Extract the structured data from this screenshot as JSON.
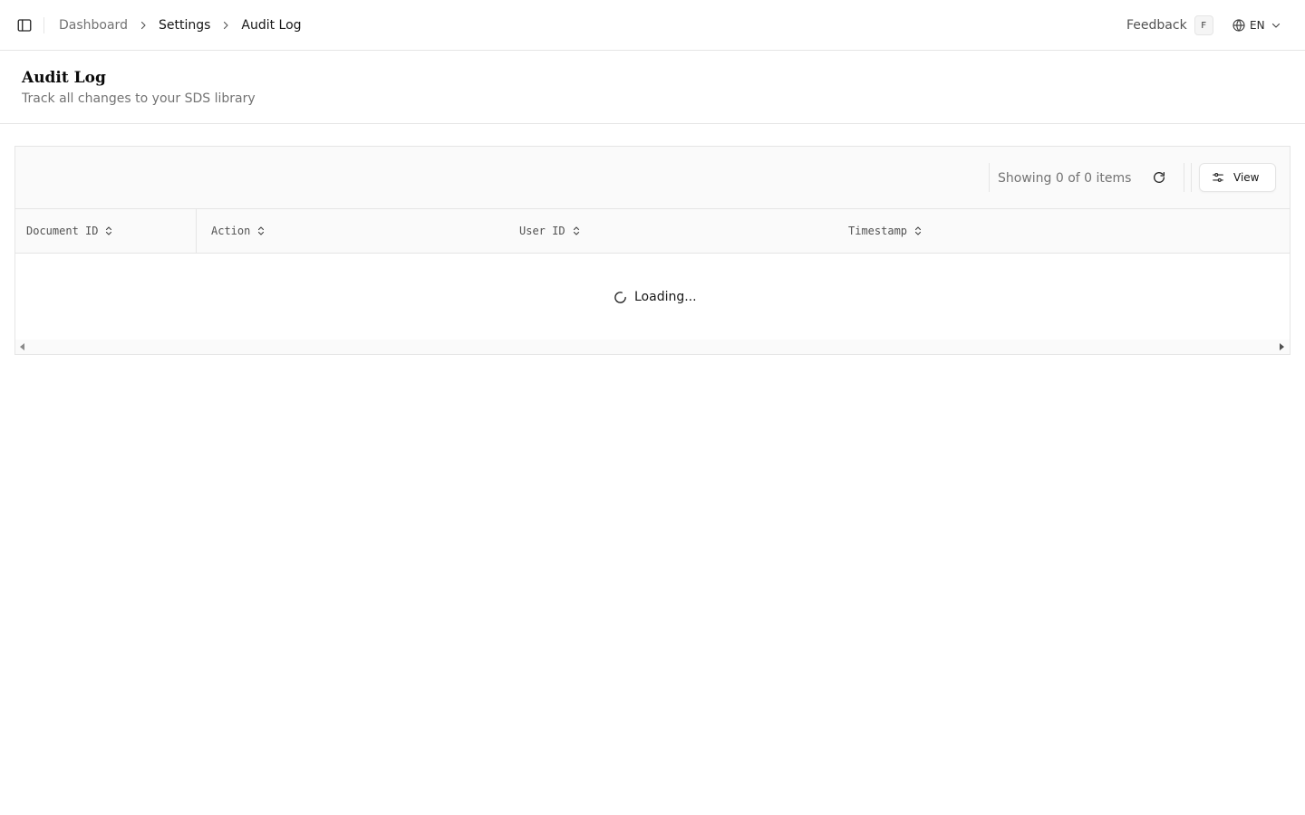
{
  "header": {
    "breadcrumb": [
      "Dashboard",
      "Settings",
      "Audit Log"
    ],
    "feedback_label": "Feedback",
    "feedback_shortcut": "F",
    "language": "EN"
  },
  "page": {
    "title": "Audit Log",
    "subtitle": "Track all changes to your SDS library"
  },
  "toolbar": {
    "showing_text": "Showing 0 of 0 items",
    "view_label": "View"
  },
  "table": {
    "columns": [
      "Document ID",
      "Action",
      "User ID",
      "Timestamp"
    ],
    "loading_text": "Loading..."
  },
  "icons": {
    "sidebar_toggle": "panel-left-icon",
    "breadcrumb_separator": "chevron-right-icon",
    "language": "globe-icon",
    "language_dropdown": "chevron-down-icon",
    "refresh": "refresh-icon",
    "view": "sliders-icon",
    "sort": "chevrons-up-down-icon",
    "loading": "spinner-icon"
  }
}
